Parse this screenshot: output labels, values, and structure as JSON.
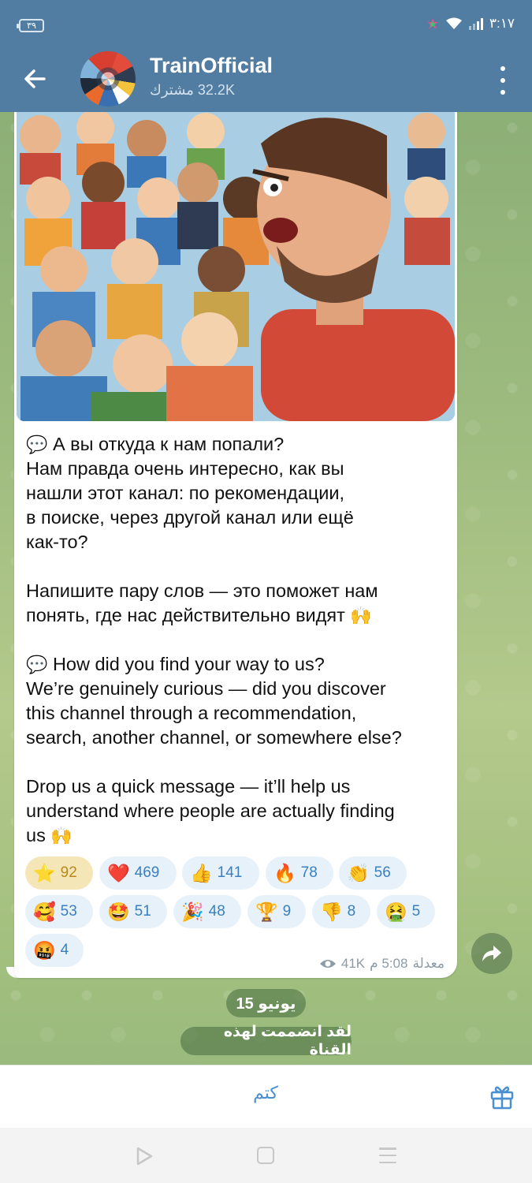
{
  "status_bar": {
    "battery": "٣٩",
    "time": "٣:١٧"
  },
  "header": {
    "title": "TrainOfficial",
    "subscribers": "32.2K مشترك",
    "back_icon": "arrow-left-icon",
    "menu_icon": "more-vertical-icon"
  },
  "post": {
    "image_description_icon": "illustration",
    "text_ru_intro": "А вы откуда к нам попали?",
    "text_ru_body": "Нам правда очень интересно, как вы\nнашли этот канал: по рекомендации,\nв поиске, через другой канал или ещё\nкак-то?",
    "text_ru_cta": "Напишите пару слов — это поможет нам\nпонять, где нас действительно видят",
    "text_en_intro": "How did you find your way to us?",
    "text_en_body": "We’re genuinely curious — did you discover\nthis channel through a recommendation,\nsearch, another channel, or somewhere else?",
    "text_en_cta": "Drop us a quick message — it’ll help us\nunderstand where people are actually finding\nus",
    "speech_emoji": "💬",
    "raised_hands_emoji": "🙌",
    "reactions": [
      {
        "emoji": "⭐",
        "count": "92",
        "selected": true
      },
      {
        "emoji": "❤️",
        "count": "469"
      },
      {
        "emoji": "👍",
        "count": "141"
      },
      {
        "emoji": "🔥",
        "count": "78"
      },
      {
        "emoji": "👏",
        "count": "56"
      },
      {
        "emoji": "🥰",
        "count": "53"
      },
      {
        "emoji": "🤩",
        "count": "51"
      },
      {
        "emoji": "🎉",
        "count": "48"
      },
      {
        "emoji": "🏆",
        "count": "9"
      },
      {
        "emoji": "👎",
        "count": "8"
      },
      {
        "emoji": "🤮",
        "count": "5"
      },
      {
        "emoji": "🤬",
        "count": "4"
      }
    ],
    "views": "41K",
    "time": "5:08 م",
    "edited": "معدلة"
  },
  "chat": {
    "date": "15 يونيو",
    "joined_notice": "لقد انضممت لهذه القناة"
  },
  "bottom_bar": {
    "mute_label": "كتم",
    "gift_icon": "gift-icon"
  },
  "colors": {
    "header": "#517da2",
    "link": "#4a8fcf",
    "reaction_bg": "#e7f1f9",
    "reaction_selected_bg": "#f5e6b8"
  }
}
